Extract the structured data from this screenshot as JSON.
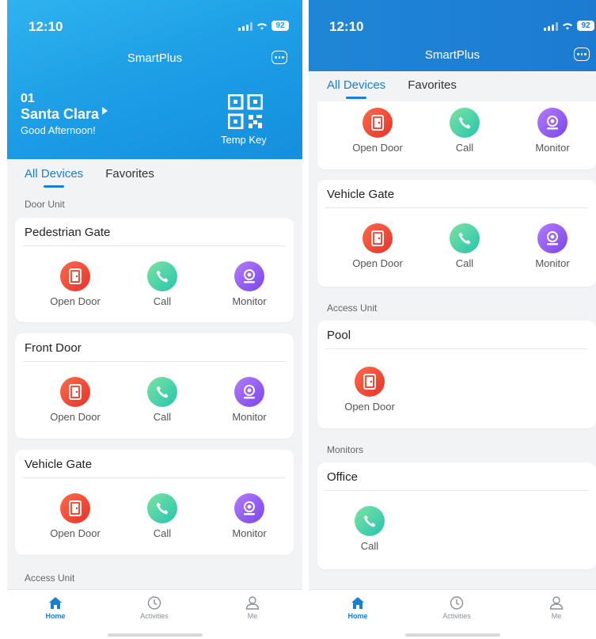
{
  "status_bar": {
    "time": "12:10",
    "battery": "92"
  },
  "app": {
    "title": "SmartPlus"
  },
  "header": {
    "unit_number": "01",
    "site": "Santa Clara",
    "greeting": "Good Afternoon!",
    "temp_key": "Temp Key"
  },
  "tabs": [
    "All Devices",
    "Favorites"
  ],
  "sections": {
    "door_unit": "Door Unit",
    "access_unit": "Access Unit",
    "monitors": "Monitors"
  },
  "devices": {
    "pedestrian_gate": "Pedestrian Gate",
    "front_door": "Front Door",
    "vehicle_gate": "Vehicle Gate",
    "pool": "Pool",
    "office": "Office"
  },
  "actions": {
    "open_door": "Open Door",
    "call": "Call",
    "monitor": "Monitor"
  },
  "tabbar": {
    "home": "Home",
    "activities": "Activities",
    "me": "Me"
  },
  "icons": [
    "chat-icon",
    "qr-code-icon",
    "door-icon",
    "phone-icon",
    "camera-icon",
    "home-icon",
    "clock-icon",
    "person-icon"
  ],
  "colors": {
    "accent": "#1a7fd0",
    "header_blue": "#1e9fe6",
    "open_door": "#e8322a",
    "call": "#27c4b0",
    "monitor": "#7b45e8"
  }
}
